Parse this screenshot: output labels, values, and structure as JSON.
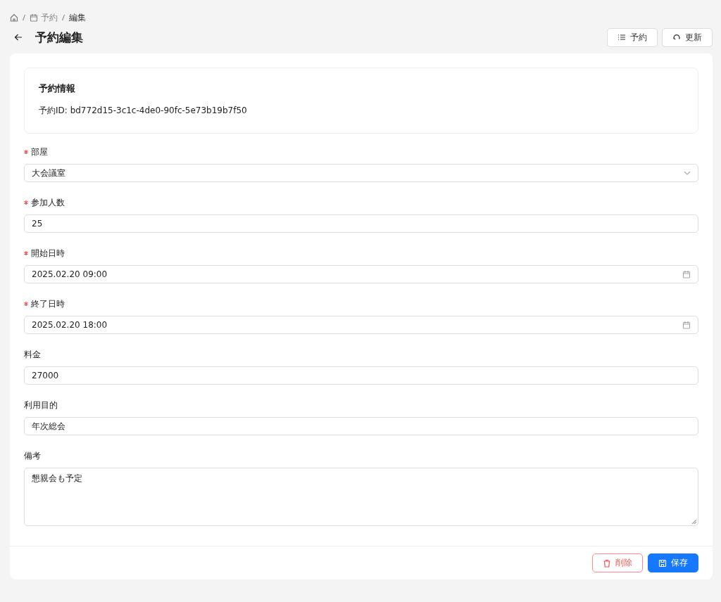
{
  "breadcrumb": [
    {
      "kind": "home"
    },
    {
      "kind": "link",
      "label": "予約"
    },
    {
      "kind": "current",
      "label": "編集"
    }
  ],
  "title": "予約編集",
  "header_buttons": [
    {
      "label": "予約"
    },
    {
      "label": "更新"
    }
  ],
  "info": {
    "title": "予約情報",
    "id_text": "予約ID: bd772d15-3c1c-4de0-90fc-5e73b19b7f50"
  },
  "fields": [
    {
      "label": "部屋",
      "required": true,
      "kind": "select",
      "value": "大会議室"
    },
    {
      "label": "参加人数",
      "required": true,
      "kind": "text",
      "value": "25"
    },
    {
      "label": "開始日時",
      "required": true,
      "kind": "date",
      "value": "2025.02.20 09:00"
    },
    {
      "label": "終了日時",
      "required": true,
      "kind": "date",
      "value": "2025.02.20 18:00"
    },
    {
      "label": "料金",
      "required": false,
      "kind": "text",
      "value": "27000"
    },
    {
      "label": "利用目的",
      "required": false,
      "kind": "text",
      "value": "年次総会"
    },
    {
      "label": "備考",
      "required": false,
      "kind": "textarea",
      "value": "懇親会も予定"
    }
  ],
  "footer_buttons": [
    {
      "label": "削除",
      "kind": "danger"
    },
    {
      "label": "保存",
      "kind": "primary"
    }
  ]
}
